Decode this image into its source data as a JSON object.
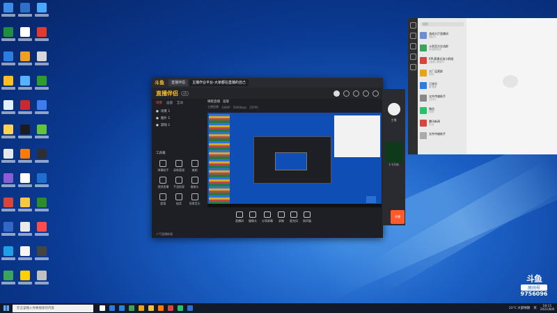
{
  "desktop": {
    "icon_colors": [
      "#3b8ee8",
      "#2e6fc9",
      "#4aa8ff",
      "#1e8f3c",
      "#ffffff",
      "#e23b2e",
      "#2a7de1",
      "#f0a020",
      "#d8d8d8",
      "#ffbf1f",
      "#55b3ff",
      "#2e9d2e",
      "#e0f0ff",
      "#c72b2b",
      "#3d7df0",
      "#ffd34a",
      "#1c1c1c",
      "#63c43a",
      "#e8e8e8",
      "#ff7a00",
      "#2f2f2f",
      "#8a5cd6",
      "#ffffff",
      "#1f6fd1",
      "#d9453b",
      "#f7c943",
      "#2b8c2b",
      "#3466c7",
      "#eaeaea",
      "#ff4d4d",
      "#1ea0e8",
      "#f5f5f5",
      "#444444",
      "#3aa55a",
      "#ffd000",
      "#c0c0c0"
    ]
  },
  "app_window": {
    "logo": "斗鱼",
    "tabs": [
      "直播伴侣",
      "主播作业平台-大家都在直播的自己"
    ],
    "brand": "直播伴侣",
    "brand_tag": "v6",
    "left_tabs": [
      "场景",
      "画面",
      "互动"
    ],
    "scenes": [
      "场景 1",
      "图片 1",
      "游戏 1"
    ],
    "tool_header": "工具箱",
    "tools": [
      "弹幕助手",
      "录制管理",
      "美颜",
      "视频直播",
      "手游投屏",
      "摄像头",
      "超管",
      "抽奖",
      "背景音乐"
    ],
    "footer": "人气直播新版",
    "center_top": [
      "横版直播",
      "竖版"
    ],
    "center_bar": [
      "主播直播",
      "1080P",
      "5000kbps",
      "25FPS"
    ],
    "bottom_controls": [
      "直播间",
      "摄像头",
      "分享屏幕",
      "录制",
      "麦克风",
      "扬声器"
    ]
  },
  "side_panel": {
    "label": "主播",
    "promo": "1-1开始",
    "button": "开播"
  },
  "chat_app": {
    "search_placeholder": "搜索",
    "items": [
      {
        "title": "游戏大厅直播间",
        "sub": "[图片]"
      },
      {
        "title": "斗鱼官方交流群",
        "sub": "欢迎新成员"
      },
      {
        "title": "KPL赛事交流小群组",
        "sub": "[语音] 通话中"
      },
      {
        "title": "大厂运营群",
        "sub": "你好"
      },
      {
        "title": "订阅号",
        "sub": "新消息"
      },
      {
        "title": "文件传输助手",
        "sub": "[文件]"
      },
      {
        "title": "微信",
        "sub": "你好"
      },
      {
        "title": "腾讯新闻",
        "sub": "热点"
      },
      {
        "title": "文件传输助手",
        "sub": ""
      }
    ]
  },
  "badge": {
    "logo": "斗鱼",
    "room_label": "房间号",
    "room_number": "9756096"
  },
  "taskbar": {
    "search_placeholder": "在这里输入你要搜索的内容",
    "weather": "33°C 大部晴朗",
    "lang": "英",
    "time": "18:11",
    "date": "2021/8/8",
    "app_colors": [
      "#ffffff",
      "#2a7de1",
      "#1e88e5",
      "#3ba55c",
      "#e8a317",
      "#f0c040",
      "#ff7a00",
      "#d9453b",
      "#23c26b",
      "#2f6fd1"
    ]
  }
}
